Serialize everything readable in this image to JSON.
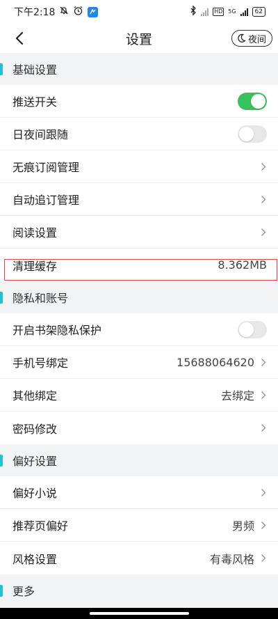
{
  "status_bar": {
    "time": "下午2:18",
    "battery": "62",
    "network": "5G",
    "hd": "HD",
    "app_badge_color": "#1e88e5"
  },
  "nav": {
    "title": "设置",
    "night_label": "夜间"
  },
  "colors": {
    "accent": "#27c1d3",
    "toggle_on": "#36c25c",
    "toggle_off": "#e7e7e7",
    "highlight": "#e0474c"
  },
  "sections": {
    "basic": {
      "title": "基础设置",
      "push": {
        "label": "推送开关",
        "state": "on"
      },
      "daynight": {
        "label": "日夜间跟随",
        "state": "off"
      },
      "incognito": {
        "label": "无痕订阅管理"
      },
      "autosub": {
        "label": "自动追订管理"
      },
      "reading": {
        "label": "阅读设置"
      },
      "cache": {
        "label": "清理缓存",
        "value": "8.362MB"
      }
    },
    "privacy": {
      "title": "隐私和账号",
      "shelf_privacy": {
        "label": "开启书架隐私保护",
        "state": "off"
      },
      "phone": {
        "label": "手机号绑定",
        "value": "15688064620"
      },
      "other_bind": {
        "label": "其他绑定",
        "value": "去绑定"
      },
      "password": {
        "label": "密码修改"
      }
    },
    "preference": {
      "title": "偏好设置",
      "novel": {
        "label": "偏好小说"
      },
      "recommend": {
        "label": "推荐页偏好",
        "value": "男频"
      },
      "style": {
        "label": "风格设置",
        "value": "有毒风格"
      }
    },
    "more": {
      "title": "更多"
    }
  }
}
